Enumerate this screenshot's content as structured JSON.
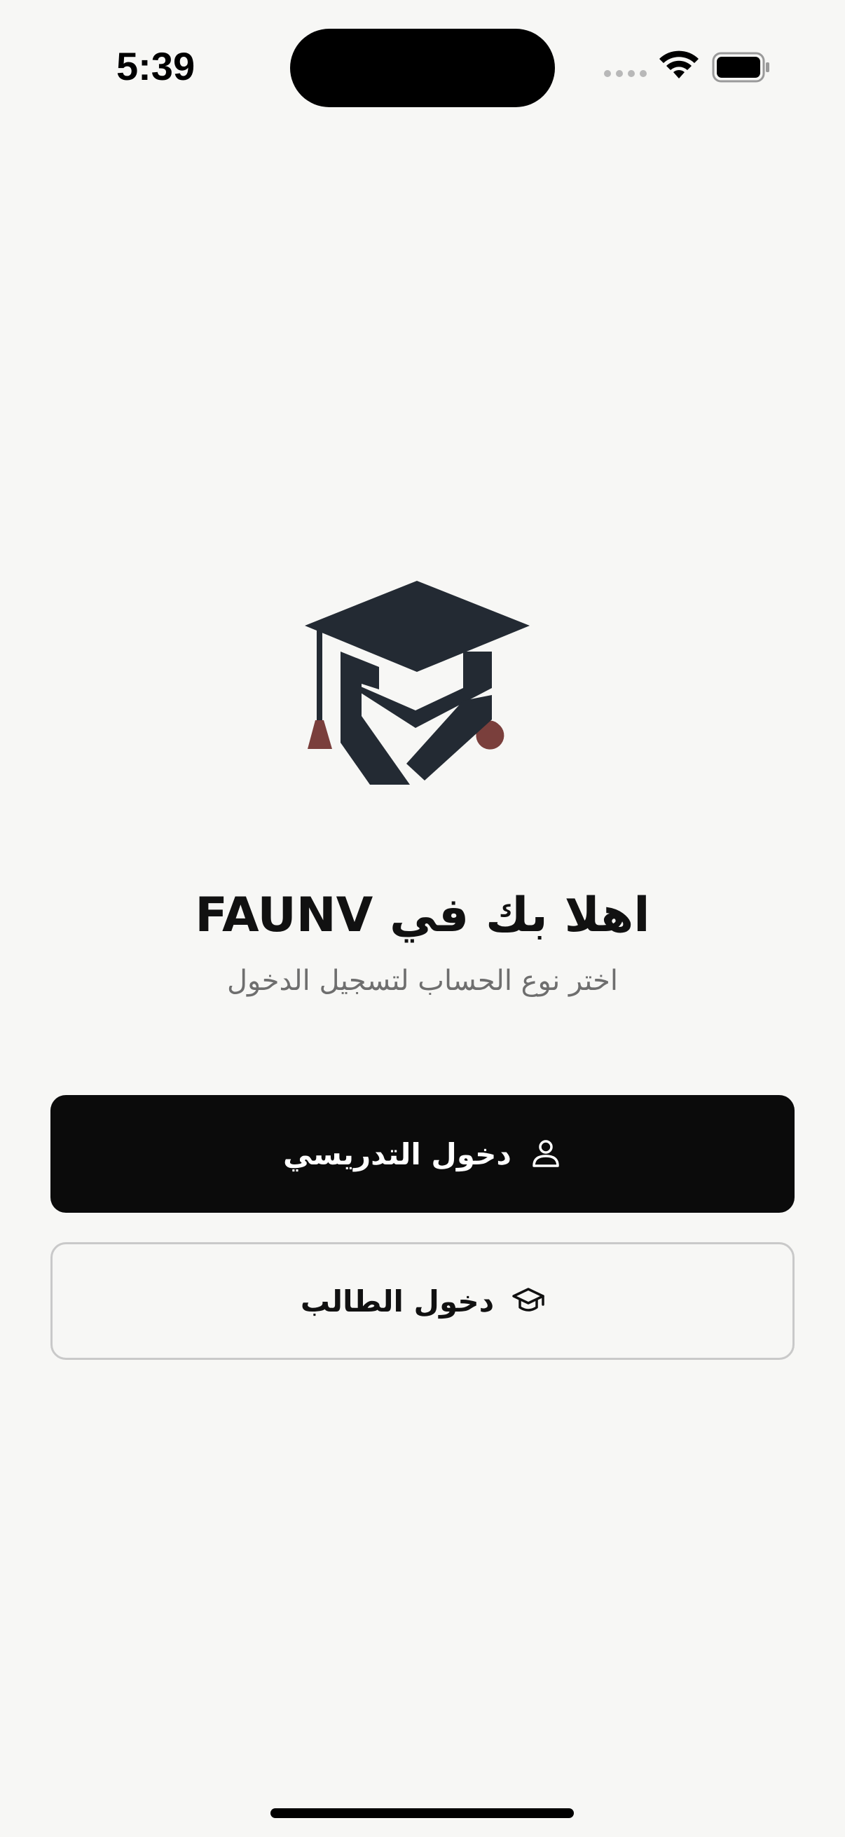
{
  "status_bar": {
    "time": "5:39"
  },
  "welcome": {
    "title": "اهلا بك في FAUNV",
    "subtitle": "اختر نوع الحساب لتسجيل الدخول"
  },
  "buttons": {
    "teacher_label": "دخول التدريسي",
    "teacher_icon": "person-icon",
    "student_label": "دخول الطالب",
    "student_icon": "graduation-cap-icon"
  },
  "colors": {
    "background": "#f7f7f5",
    "primary_button": "#0b0b0b",
    "logo_dark": "#232a33",
    "logo_accent": "#7a3f3c"
  }
}
